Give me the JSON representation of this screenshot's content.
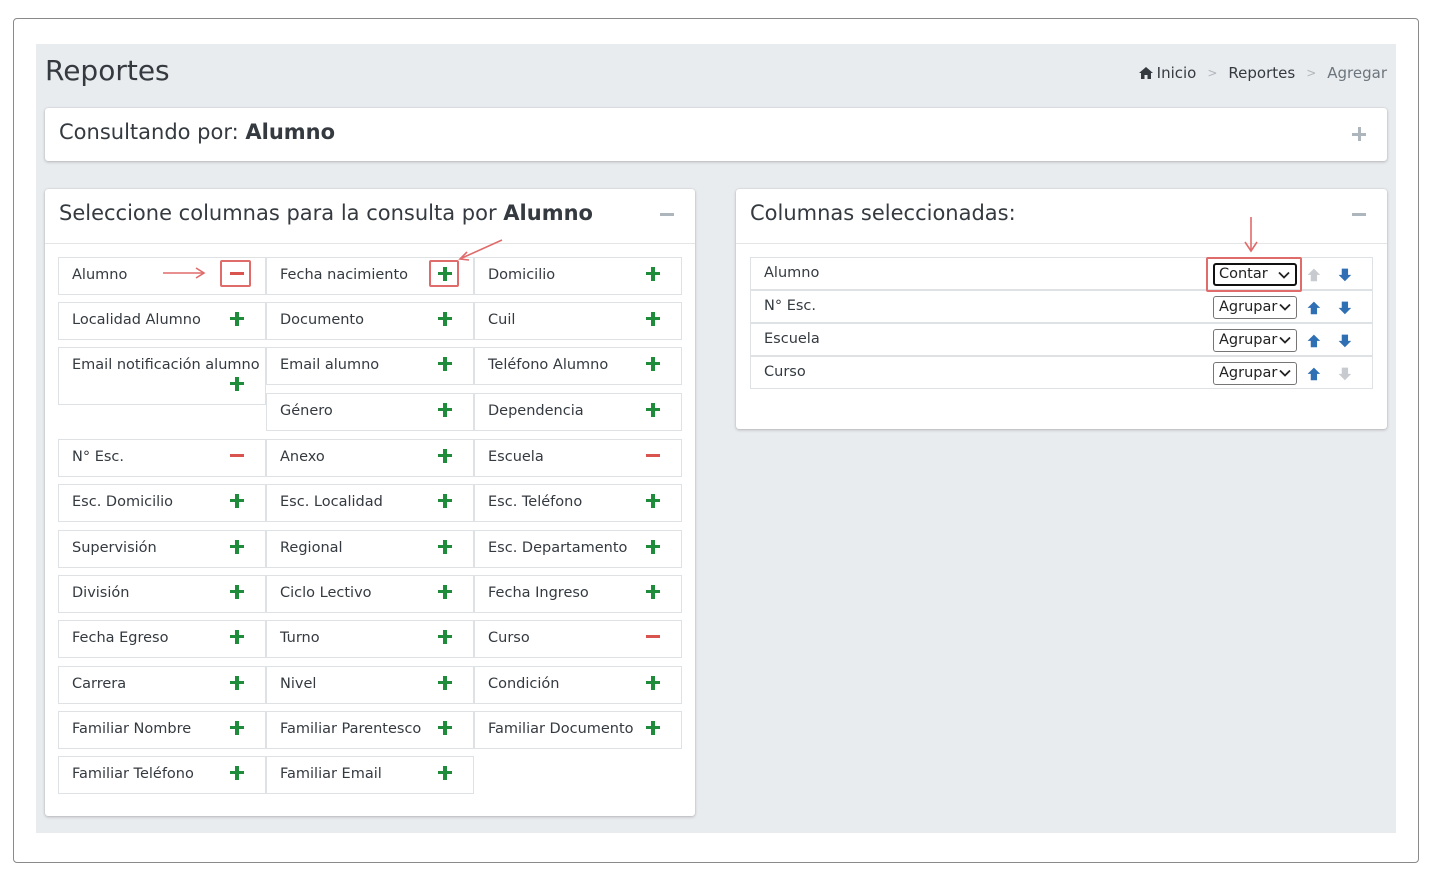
{
  "page": {
    "title": "Reportes",
    "breadcrumb": [
      {
        "label": "Inicio",
        "icon": "home-icon"
      },
      {
        "label": "Reportes"
      },
      {
        "label": "Agregar"
      }
    ],
    "breadcrumb_separator": ">"
  },
  "query_card": {
    "prefix": "Consultando por:",
    "entity": "Alumno",
    "tool": "plus"
  },
  "columns_card": {
    "prefix": "Seleccione columnas para la consulta por",
    "entity": "Alumno",
    "tool": "minus",
    "columns": [
      [
        {
          "label": "Alumno",
          "state": "selected"
        },
        {
          "label": "Localidad Alumno",
          "state": "available"
        },
        {
          "label": "Email notificación alumno",
          "state": "available"
        },
        {
          "label": "N° Esc.",
          "state": "selected"
        },
        {
          "label": "Esc. Domicilio",
          "state": "available"
        },
        {
          "label": "Supervisión",
          "state": "available"
        },
        {
          "label": "División",
          "state": "available"
        },
        {
          "label": "Fecha Egreso",
          "state": "available"
        },
        {
          "label": "Carrera",
          "state": "available"
        },
        {
          "label": "Familiar Nombre",
          "state": "available"
        },
        {
          "label": "Familiar Teléfono",
          "state": "available"
        }
      ],
      [
        {
          "label": "Fecha nacimiento",
          "state": "available"
        },
        {
          "label": "Documento",
          "state": "available"
        },
        {
          "label": "Email alumno",
          "state": "available"
        },
        {
          "label": "Género",
          "state": "available"
        },
        {
          "label": "Anexo",
          "state": "available"
        },
        {
          "label": "Esc. Localidad",
          "state": "available"
        },
        {
          "label": "Regional",
          "state": "available"
        },
        {
          "label": "Ciclo Lectivo",
          "state": "available"
        },
        {
          "label": "Turno",
          "state": "available"
        },
        {
          "label": "Nivel",
          "state": "available"
        },
        {
          "label": "Familiar Parentesco",
          "state": "available"
        },
        {
          "label": "Familiar Email",
          "state": "available"
        }
      ],
      [
        {
          "label": "Domicilio",
          "state": "available"
        },
        {
          "label": "Cuil",
          "state": "available"
        },
        {
          "label": "Teléfono Alumno",
          "state": "available"
        },
        {
          "label": "Dependencia",
          "state": "available"
        },
        {
          "label": "Escuela",
          "state": "selected"
        },
        {
          "label": "Esc. Teléfono",
          "state": "available"
        },
        {
          "label": "Esc. Departamento",
          "state": "available"
        },
        {
          "label": "Fecha Ingreso",
          "state": "available"
        },
        {
          "label": "Curso",
          "state": "selected"
        },
        {
          "label": "Condición",
          "state": "available"
        },
        {
          "label": "Familiar Documento",
          "state": "available"
        }
      ]
    ]
  },
  "selected_card": {
    "title": "Columnas seleccionadas:",
    "tool": "minus",
    "rows": [
      {
        "label": "Alumno",
        "aggregation": "Contar",
        "up_enabled": false,
        "down_enabled": true
      },
      {
        "label": "N° Esc.",
        "aggregation": "Agrupar",
        "up_enabled": true,
        "down_enabled": true
      },
      {
        "label": "Escuela",
        "aggregation": "Agrupar",
        "up_enabled": true,
        "down_enabled": true
      },
      {
        "label": "Curso",
        "aggregation": "Agrupar",
        "up_enabled": true,
        "down_enabled": false
      }
    ]
  },
  "colors": {
    "add": "#1e8c3a",
    "remove": "#d9534f",
    "arrow_enabled": "#2f6fb3",
    "arrow_disabled": "#c7cbcf",
    "highlight": "#e06b6b",
    "background": "#e9ecef"
  }
}
